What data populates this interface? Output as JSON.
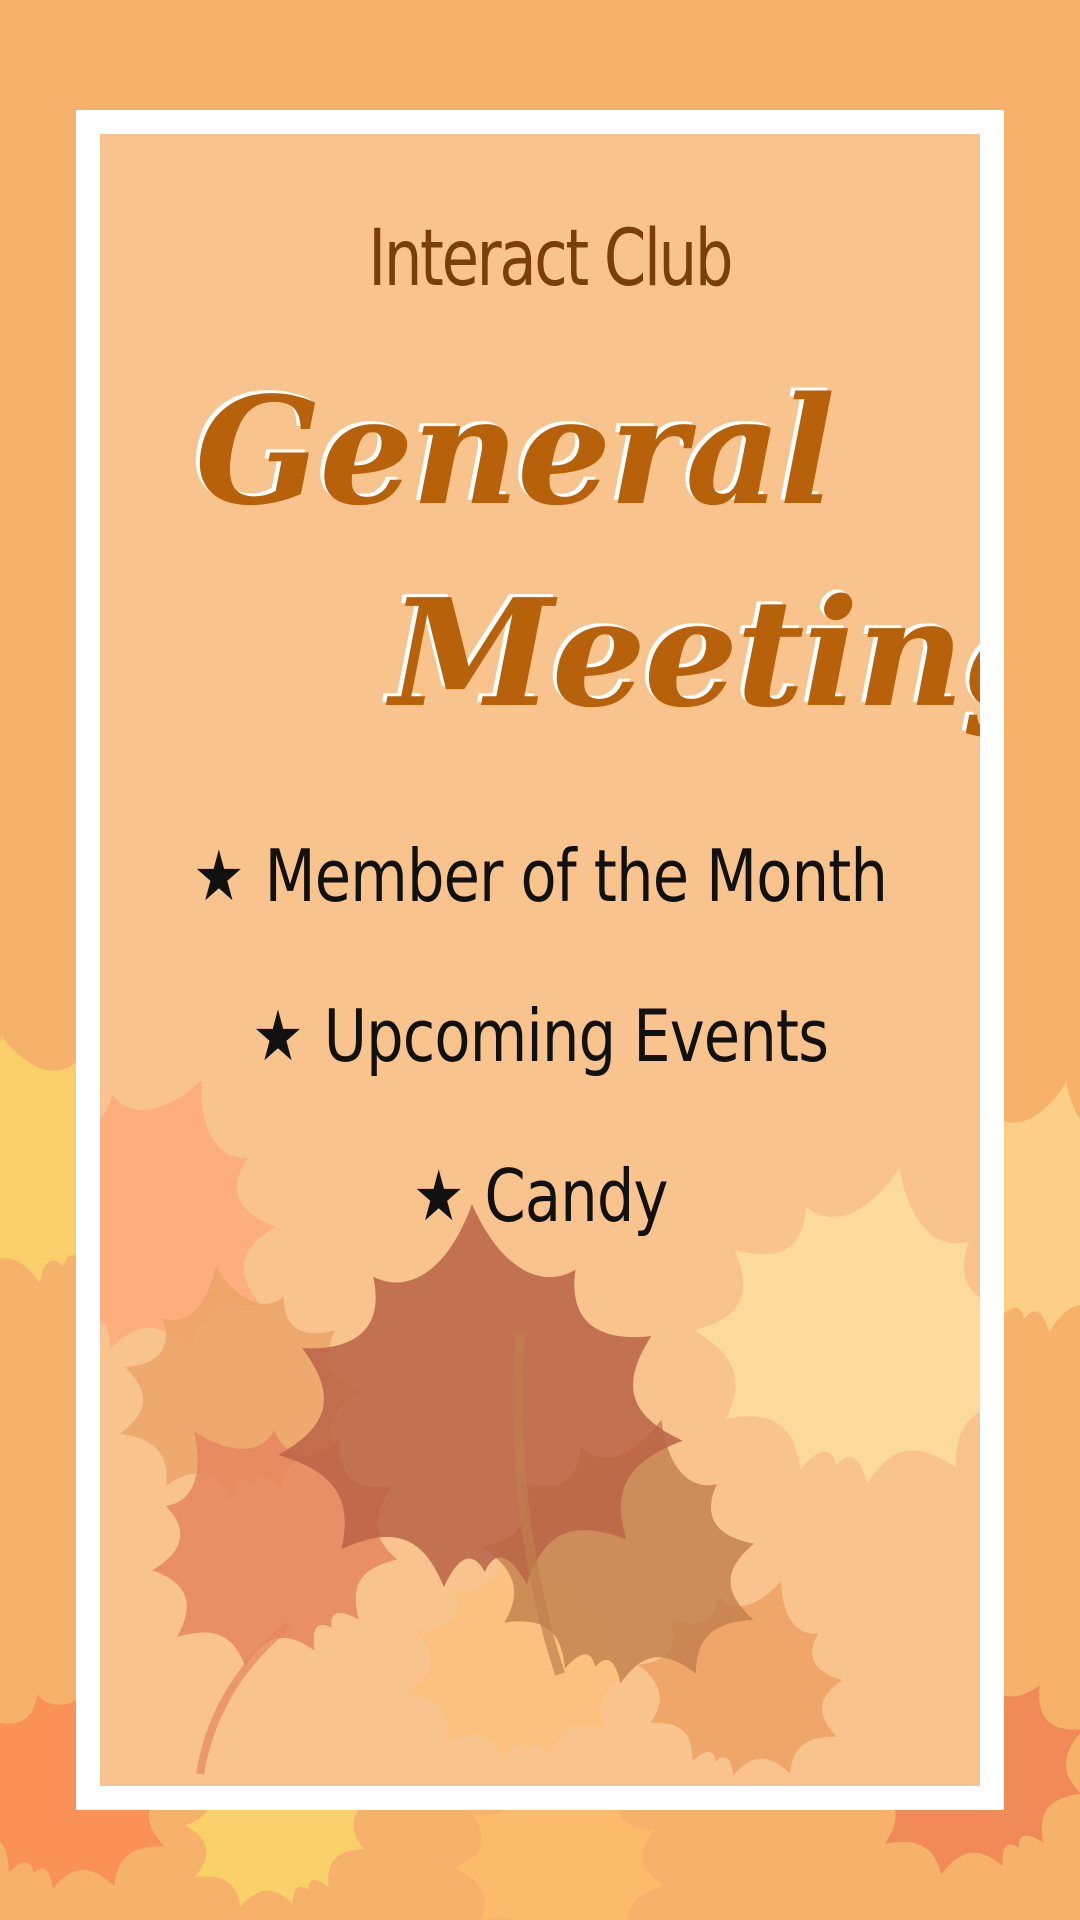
{
  "poster": {
    "club_name": "Interact Club",
    "title_line1": "General",
    "title_line2": "Meeting",
    "agenda": [
      {
        "icon": "star-icon",
        "label": "Member of the Month"
      },
      {
        "icon": "star-icon",
        "label": "Upcoming Events"
      },
      {
        "icon": "star-icon",
        "label": "Candy"
      }
    ],
    "star_glyph": "★"
  },
  "colors": {
    "background": "#f6b26b",
    "panel": "#f9c38d",
    "frame": "#ffffff",
    "club_text": "#7a3e0a",
    "title_text": "#b8610b",
    "agenda_text": "#111111"
  }
}
